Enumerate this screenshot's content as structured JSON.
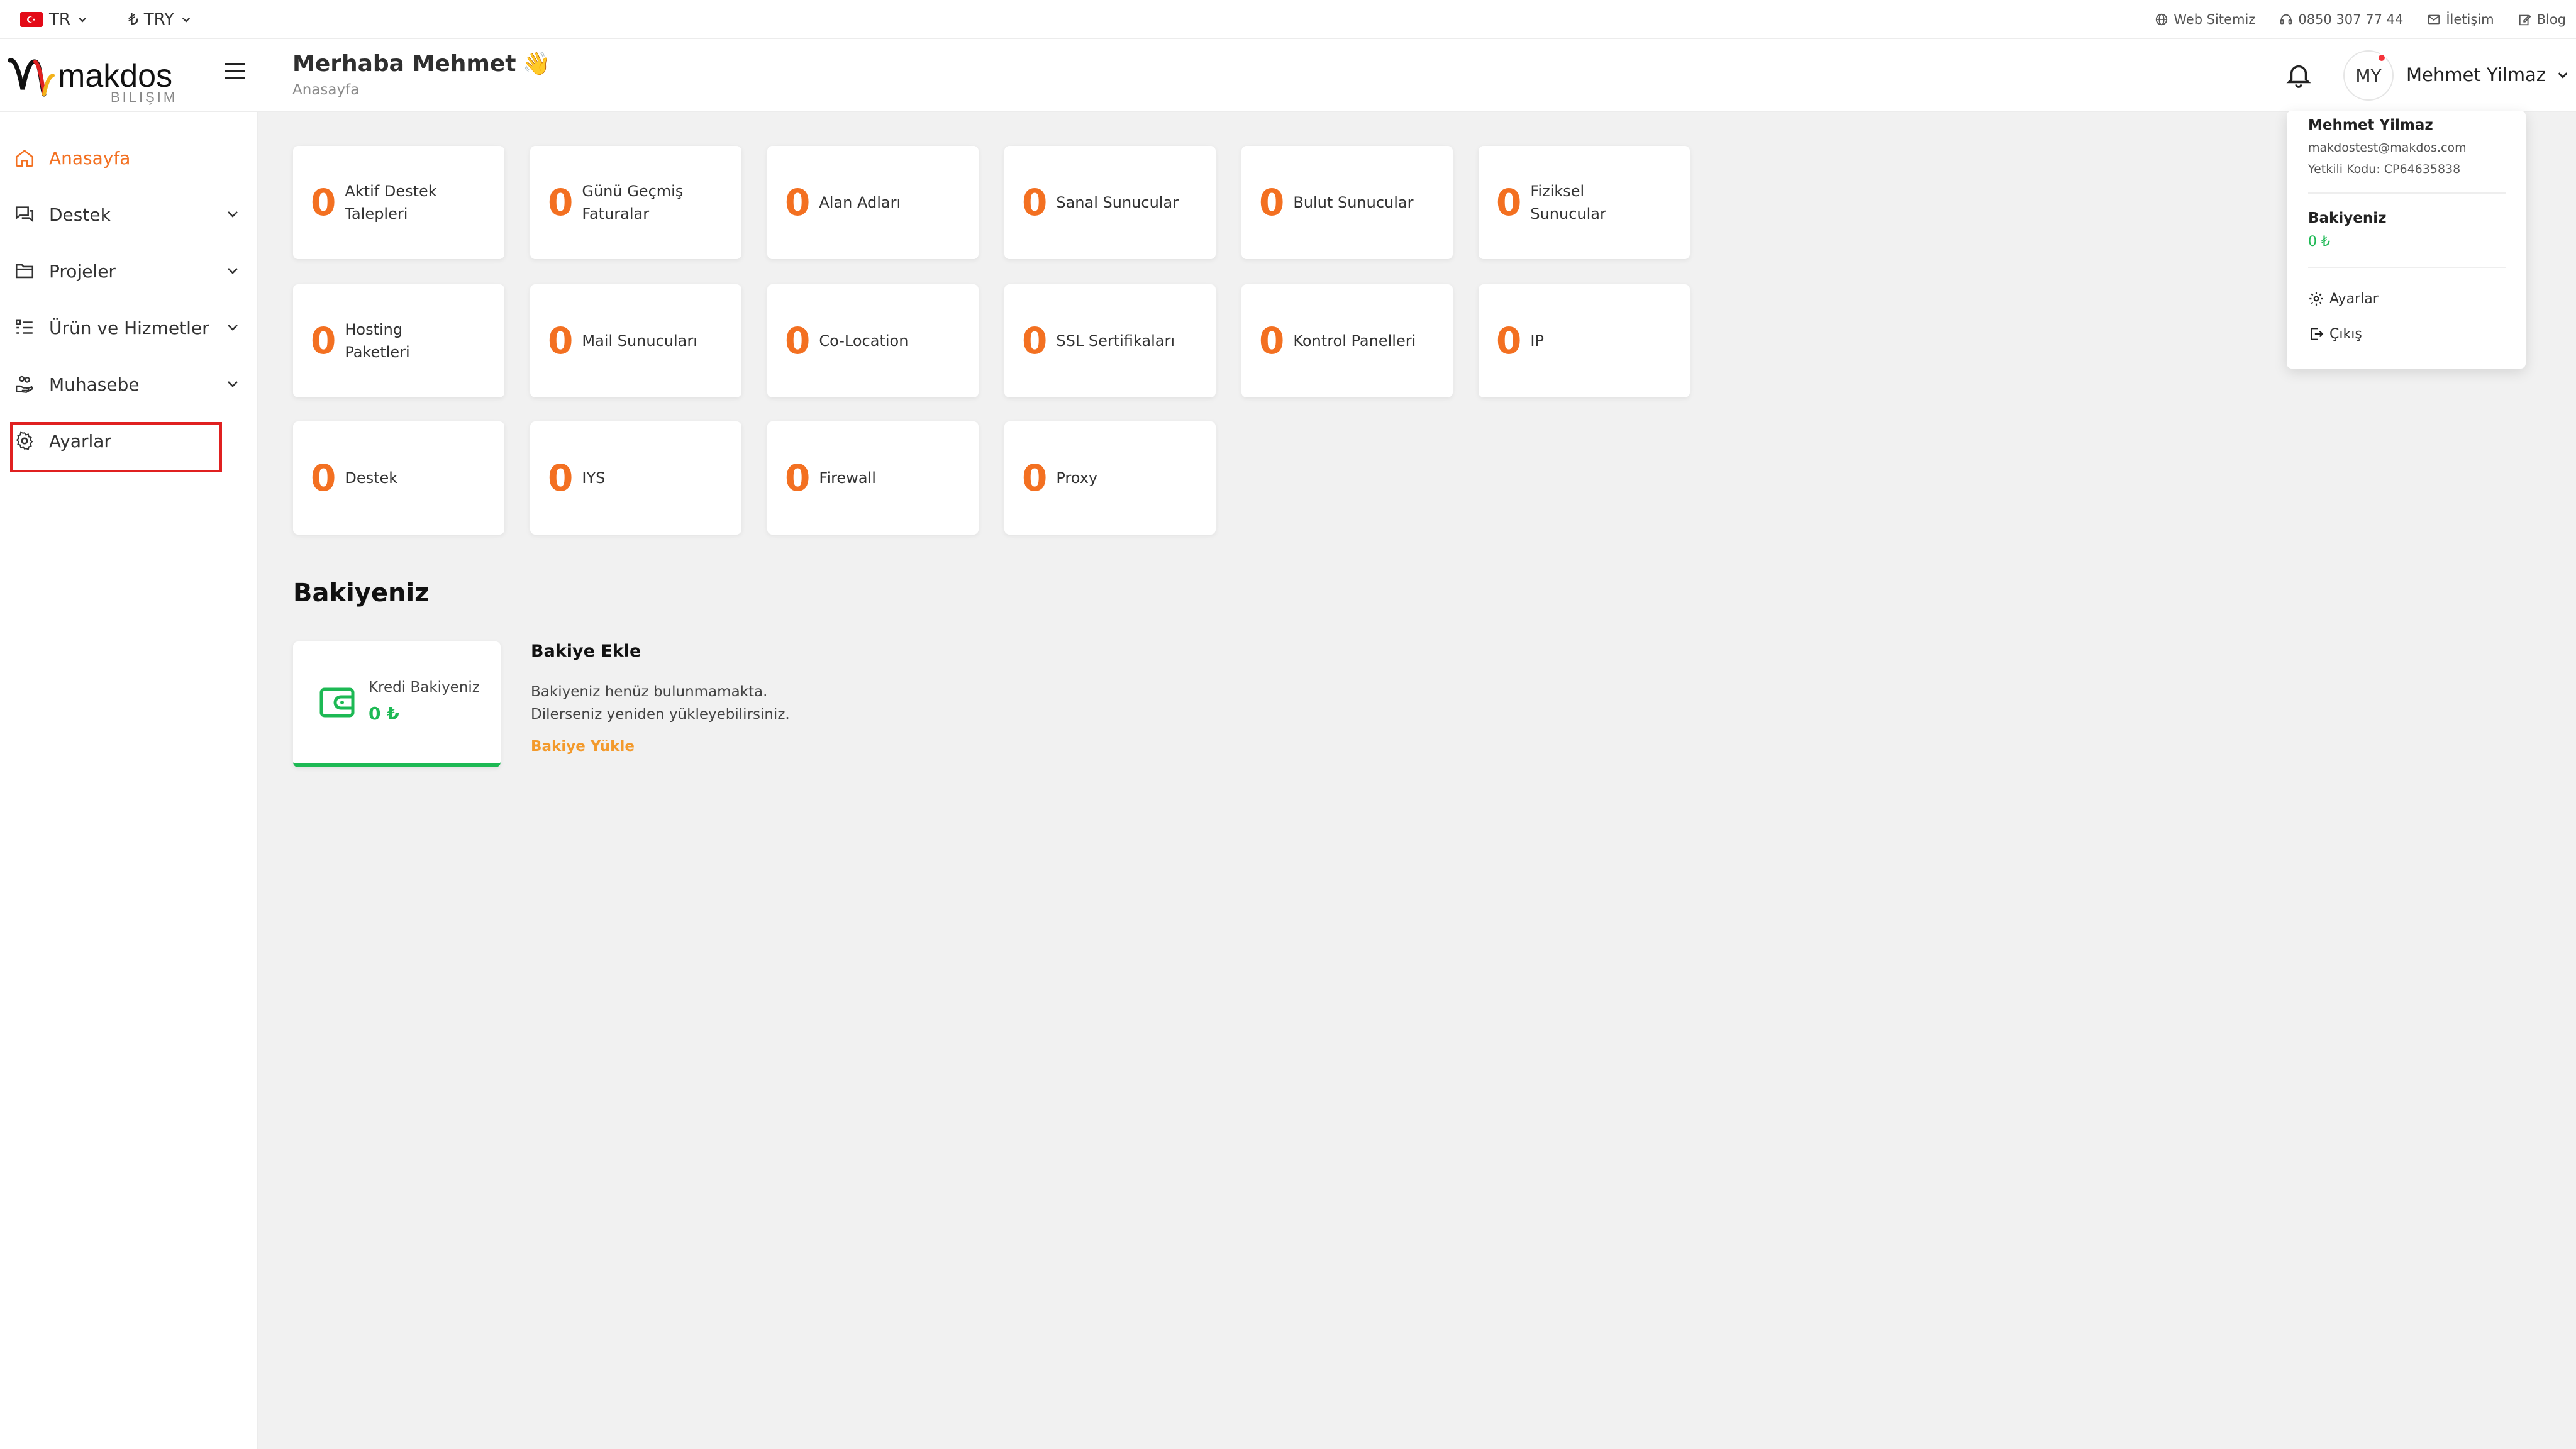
{
  "topbar": {
    "language": "TR",
    "currency": "₺ TRY",
    "links": [
      {
        "label": "Web Sitemiz",
        "icon": "globe-icon"
      },
      {
        "label": "0850 307 77 44",
        "icon": "headset-icon"
      },
      {
        "label": "İletişim",
        "icon": "mail-icon"
      },
      {
        "label": "Blog",
        "icon": "edit-icon"
      }
    ]
  },
  "header": {
    "logo_text": "makdos",
    "logo_subtext": "BILIŞIM",
    "greeting": "Merhaba Mehmet",
    "greeting_emoji": "👋",
    "breadcrumb": "Anasayfa",
    "avatar_initials": "MY",
    "user_name": "Mehmet Yilmaz"
  },
  "dropdown": {
    "name": "Mehmet Yilmaz",
    "email": "makdostest@makdos.com",
    "auth_code": "Yetkili Kodu: CP64635838",
    "balance_title": "Bakiyeniz",
    "balance_value": "0 ₺",
    "settings": "Ayarlar",
    "logout": "Çıkış"
  },
  "sidebar": {
    "items": [
      {
        "label": "Anasayfa",
        "icon": "home-icon",
        "active": true
      },
      {
        "label": "Destek",
        "icon": "chat-icon"
      },
      {
        "label": "Projeler",
        "icon": "folder-icon"
      },
      {
        "label": "Ürün ve Hizmetler",
        "icon": "list-icon"
      },
      {
        "label": "Muhasebe",
        "icon": "hand-coins-icon"
      },
      {
        "label": "Ayarlar",
        "icon": "gear-icon"
      }
    ]
  },
  "stats": [
    {
      "value": "0",
      "label": "Aktif Destek Talepleri"
    },
    {
      "value": "0",
      "label": "Günü Geçmiş Faturalar"
    },
    {
      "value": "0",
      "label": "Alan Adları"
    },
    {
      "value": "0",
      "label": "Sanal Sunucular"
    },
    {
      "value": "0",
      "label": "Bulut Sunucular"
    },
    {
      "value": "0",
      "label": "Fiziksel Sunucular"
    },
    {
      "value": "0",
      "label": "Hosting Paketleri"
    },
    {
      "value": "0",
      "label": "Mail Sunucuları"
    },
    {
      "value": "0",
      "label": "Co-Location"
    },
    {
      "value": "0",
      "label": "SSL Sertifikaları"
    },
    {
      "value": "0",
      "label": "Kontrol Panelleri"
    },
    {
      "value": "0",
      "label": "IP"
    },
    {
      "value": "0",
      "label": "Destek"
    },
    {
      "value": "0",
      "label": "IYS"
    },
    {
      "value": "0",
      "label": "Firewall"
    },
    {
      "value": "0",
      "label": "Proxy"
    }
  ],
  "balance": {
    "section_title": "Bakiyeniz",
    "card_label": "Kredi Bakiyeniz",
    "card_value": "0 ₺",
    "add_title": "Bakiye Ekle",
    "add_line1": "Bakiyeniz henüz bulunmamakta.",
    "add_line2": "Dilerseniz yeniden yükleyebilirsiniz.",
    "add_link": "Bakiye Yükle"
  },
  "colors": {
    "accent": "#f37021",
    "success": "#1db954",
    "link_orange": "#f39a2c",
    "highlight_red": "#e02020"
  }
}
